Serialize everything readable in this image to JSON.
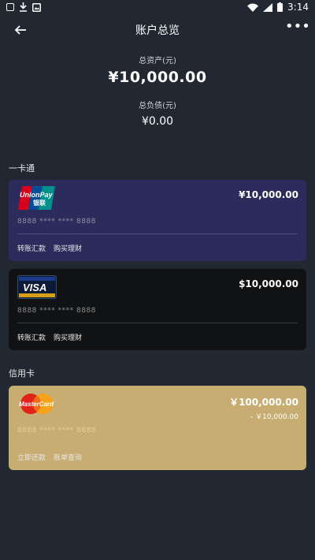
{
  "status_bar": {
    "time": "3:14"
  },
  "header": {
    "title": "账户总览",
    "more": "•••"
  },
  "summary": {
    "total_assets_label": "总资产(元)",
    "total_assets_value": "¥10,000.00",
    "total_liabilities_label": "总负债(元)",
    "total_liabilities_value": "¥0.00"
  },
  "sections": {
    "debit_title": "一卡通",
    "credit_title": "信用卡"
  },
  "cards": [
    {
      "brand": "UnionPay 银联",
      "brand_top": "UnionPay",
      "brand_bottom": "银联",
      "amount": "¥10,000.00",
      "number": "8888 **** **** 8888",
      "actions": [
        "转账汇款",
        "购买理财"
      ]
    },
    {
      "brand": "VISA",
      "amount": "$10,000.00",
      "number": "8888 **** **** 8888",
      "actions": [
        "转账汇款",
        "购买理财"
      ]
    },
    {
      "brand": "MasterCard",
      "amount": "￥100,000.00",
      "sub_amount": "- ￥10,000.00",
      "number": "8888 **** **** 8888",
      "actions": [
        "立即还款",
        "账单查询"
      ]
    }
  ],
  "colors": {
    "background": "#222831",
    "unionpay_card": "#2b2c5c",
    "visa_card": "#111214",
    "mastercard_card": "#c8ad72"
  }
}
